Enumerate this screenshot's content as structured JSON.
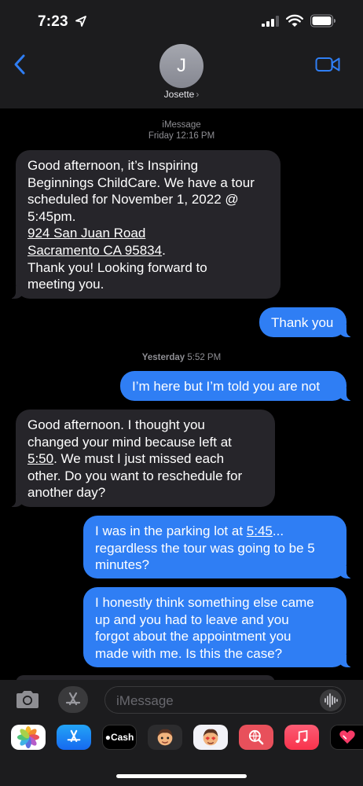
{
  "status_bar": {
    "time": "7:23"
  },
  "header": {
    "avatar_initial": "J",
    "contact_name": "Josette",
    "chevron": "›"
  },
  "thread": {
    "service": "iMessage",
    "timestamp1": "Friday 12:16 PM",
    "timestamp2_day": "Yesterday",
    "timestamp2_time": "5:52 PM",
    "messages": [
      {
        "direction": "incoming",
        "lines": [
          "Good afternoon, it’s Inspiring",
          "Beginnings ChildCare. We have a tour",
          "scheduled for November 1, 2022 @",
          "5:45pm.",
          "924 San Juan Road",
          "Sacramento CA 95834",
          ".",
          "Thank you! Looking forward to",
          "meeting you."
        ]
      },
      {
        "direction": "outgoing",
        "text": "Thank you"
      },
      {
        "direction": "outgoing",
        "text": "I’m here but I’m told you are not"
      },
      {
        "direction": "incoming",
        "lines": [
          "Good afternoon. I thought you",
          "changed your mind because left at",
          "5:50",
          ". We must I just missed each",
          "other. Do you want to reschedule for",
          "another day?"
        ]
      },
      {
        "direction": "outgoing",
        "lines": [
          "I was in the parking lot at ",
          "5:45",
          "...",
          "regardless the tour was going to be 5",
          "minutes?"
        ]
      },
      {
        "direction": "outgoing",
        "lines": [
          "I honestly think something else came",
          "up and you had to leave and you",
          "forgot about the appointment you",
          "made with me. Is this the case?"
        ]
      }
    ]
  },
  "compose": {
    "placeholder": "iMessage"
  },
  "app_drawer": {
    "apps": [
      "photos-app",
      "app-store-app",
      "apple-cash-app",
      "memoji-app",
      "memoji-stickers-app",
      "images-search-app",
      "music-app",
      "digital-touch-app"
    ],
    "cash_label": "Cash"
  },
  "colors": {
    "outgoing_bubble": "#2f7ef4",
    "incoming_bubble": "#26252a",
    "accent": "#2f7ef4"
  }
}
